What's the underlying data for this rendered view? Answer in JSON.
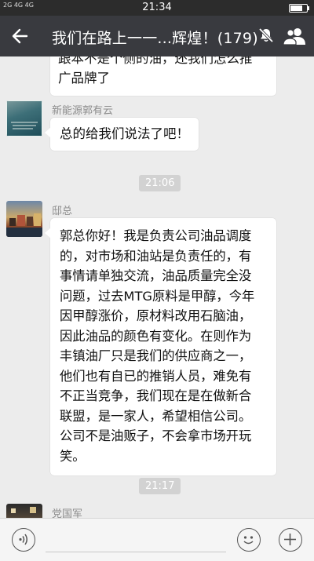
{
  "status_bar": {
    "network": "2G 4G 4G",
    "time": "21:34"
  },
  "header": {
    "title": "我们在路上一一...辉煌！(179)",
    "back_icon": "back-arrow-icon",
    "mute_icon": "mute-icon",
    "group_icon": "group-members-icon"
  },
  "messages": [
    {
      "type": "partial",
      "line1": "跟本不是个侧的油，还我们怎么推",
      "line2": "广品牌了"
    },
    {
      "sender": "新能源郭有云",
      "avatar_caption": "生命中的事情，都是来自...",
      "text": "总的给我们说法了吧！"
    },
    {
      "type": "time",
      "text": "21:06"
    },
    {
      "sender": "邸总",
      "lines": [
        "郭总你好！我是负责公司油品调度",
        "的，对市场和油站是负责任的，有",
        "事情请单独交流，油品质量完全没",
        "问题，过去MTG原料是甲醇，今年",
        "因甲醇涨价，原材料改用石脑油，",
        "因此油品的颜色有变化。在则作为",
        "丰镇油厂只是我们的供应商之一，",
        "他们也有自已的推销人员，难免有",
        "不正当竞争，我们现在是在做新合",
        "联盟，是一家人，希望相信公司。",
        "公司不是油贩子，不会拿市场开玩",
        "笑。"
      ]
    },
    {
      "type": "time",
      "text": "21:17"
    },
    {
      "sender": "党国军"
    }
  ],
  "input_bar": {
    "voice_icon": "voice-icon",
    "emoji_icon": "emoji-icon",
    "plus_icon": "plus-icon"
  },
  "colors": {
    "status_bar": "#2c2c2c",
    "title_bar": "#393a3f",
    "chat_bg": "#ececec",
    "bubble": "#ffffff",
    "time_pill": "#d2d2d2"
  }
}
